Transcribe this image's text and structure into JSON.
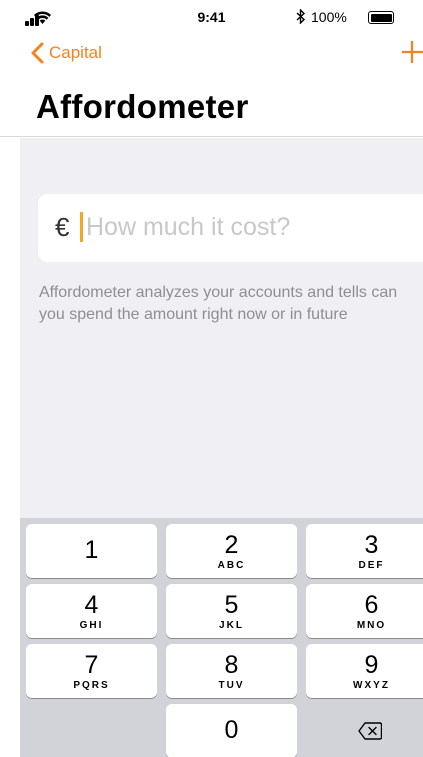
{
  "status_bar": {
    "time": "9:41",
    "bluetooth": "∗",
    "battery": "100%",
    "icons": [
      "signal-bars-icon",
      "wifi-icon",
      "bluetooth-icon",
      "battery-icon"
    ]
  },
  "nav": {
    "back_label": "Capital",
    "title": "Affordometer",
    "add_icon": "plus-icon",
    "back_icon": "chevron-left-icon"
  },
  "amount": {
    "currency_symbol": "€",
    "value": "",
    "placeholder": "How much it cost?"
  },
  "hint_text": "Affordometer analyzes your accounts and tells can you spend the amount right now or in future",
  "keypad": {
    "keys": [
      {
        "digit": "1",
        "letters": ""
      },
      {
        "digit": "2",
        "letters": "ABC"
      },
      {
        "digit": "3",
        "letters": "DEF"
      },
      {
        "digit": "4",
        "letters": "GHI"
      },
      {
        "digit": "5",
        "letters": "JKL"
      },
      {
        "digit": "6",
        "letters": "MNO"
      },
      {
        "digit": "7",
        "letters": "PQRS"
      },
      {
        "digit": "8",
        "letters": "TUV"
      },
      {
        "digit": "9",
        "letters": "WXYZ"
      },
      {
        "digit": "0",
        "letters": ""
      }
    ],
    "delete_icon": "backspace-icon"
  },
  "colors": {
    "accent": "#f5821f",
    "caret": "#f5a623",
    "background": "#efeff4",
    "keyboard": "#d1d3d9",
    "hint": "#8e8e93"
  }
}
